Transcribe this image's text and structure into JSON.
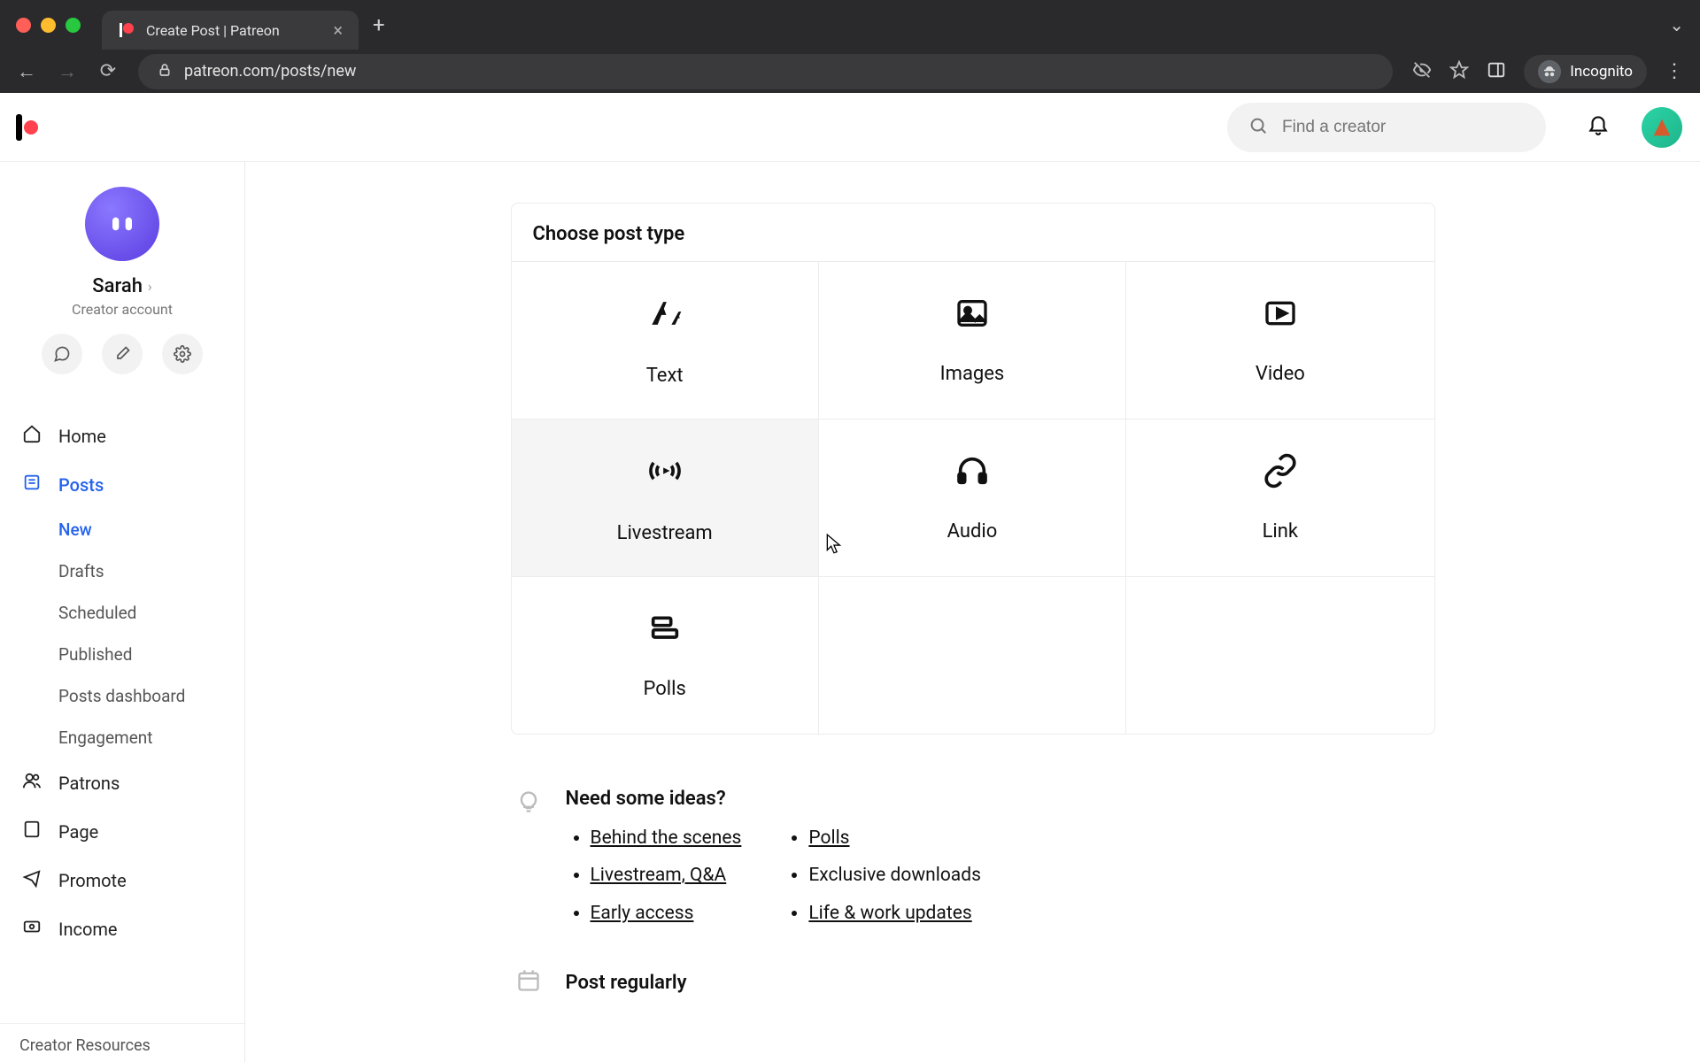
{
  "browser": {
    "tab_title": "Create Post | Patreon",
    "url": "patreon.com/posts/new",
    "incognito_label": "Incognito"
  },
  "header": {
    "search_placeholder": "Find a creator"
  },
  "profile": {
    "name": "Sarah",
    "subtitle": "Creator account"
  },
  "sidebar": {
    "items": [
      {
        "id": "home",
        "label": "Home"
      },
      {
        "id": "posts",
        "label": "Posts"
      },
      {
        "id": "patrons",
        "label": "Patrons"
      },
      {
        "id": "page",
        "label": "Page"
      },
      {
        "id": "promote",
        "label": "Promote"
      },
      {
        "id": "income",
        "label": "Income"
      }
    ],
    "posts_sub": [
      {
        "id": "new",
        "label": "New"
      },
      {
        "id": "drafts",
        "label": "Drafts"
      },
      {
        "id": "scheduled",
        "label": "Scheduled"
      },
      {
        "id": "published",
        "label": "Published"
      },
      {
        "id": "dashboard",
        "label": "Posts dashboard"
      },
      {
        "id": "engagement",
        "label": "Engagement"
      }
    ],
    "footer": "Creator Resources"
  },
  "card": {
    "title": "Choose post type",
    "tiles": [
      {
        "id": "text",
        "label": "Text"
      },
      {
        "id": "images",
        "label": "Images"
      },
      {
        "id": "video",
        "label": "Video"
      },
      {
        "id": "livestream",
        "label": "Livestream"
      },
      {
        "id": "audio",
        "label": "Audio"
      },
      {
        "id": "link",
        "label": "Link"
      },
      {
        "id": "polls",
        "label": "Polls"
      }
    ]
  },
  "ideas": {
    "title": "Need some ideas?",
    "col1": [
      {
        "label": "Behind the scenes",
        "link": true
      },
      {
        "label": "Livestream, Q&A",
        "link": true
      },
      {
        "label": "Early access",
        "link": true
      }
    ],
    "col2": [
      {
        "label": "Polls",
        "link": true
      },
      {
        "label": "Exclusive downloads",
        "link": false
      },
      {
        "label": "Life & work updates",
        "link": true
      }
    ]
  },
  "post_regularly": {
    "title": "Post regularly"
  },
  "colors": {
    "brand_red": "#ff424d",
    "active_blue": "#2563eb"
  }
}
